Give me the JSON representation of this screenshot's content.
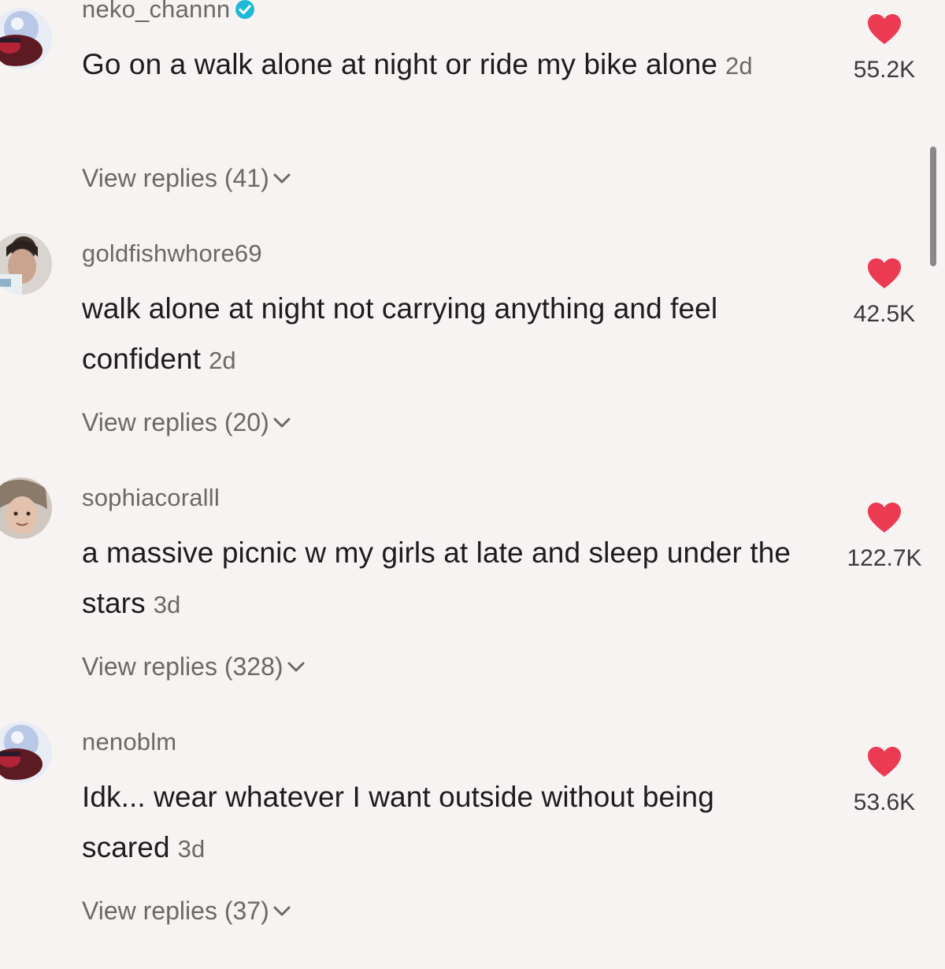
{
  "comments": [
    {
      "username": "neko_channn",
      "verified": true,
      "text": "Go on a walk alone at night or ride my bike alone",
      "age": "2d",
      "replies": "View replies (41)",
      "likes": "55.2K",
      "avatar": "blue-haired-anime-avatar"
    },
    {
      "username": "goldfishwhore69",
      "verified": false,
      "text": "walk alone at night not carrying anything and feel confident",
      "age": "2d",
      "replies": "View replies (20)",
      "likes": "42.5K",
      "avatar": "selfie-photo-avatar"
    },
    {
      "username": "sophiacoralll",
      "verified": false,
      "text": "a massive picnic w my girls at late and sleep under the stars",
      "age": "3d",
      "replies": "View replies (328)",
      "likes": "122.7K",
      "avatar": "face-photo-avatar"
    },
    {
      "username": "nenoblm",
      "verified": false,
      "text": "Idk... wear whatever I want outside without being scared",
      "age": "3d",
      "replies": "View replies (37)",
      "likes": "53.6K",
      "avatar": "blue-haired-anime-avatar"
    }
  ],
  "colors": {
    "background": "#f8f3f3",
    "heart": "#ec3a52",
    "muted_text": "#6d6868",
    "verified_badge": "#20b8d8"
  }
}
